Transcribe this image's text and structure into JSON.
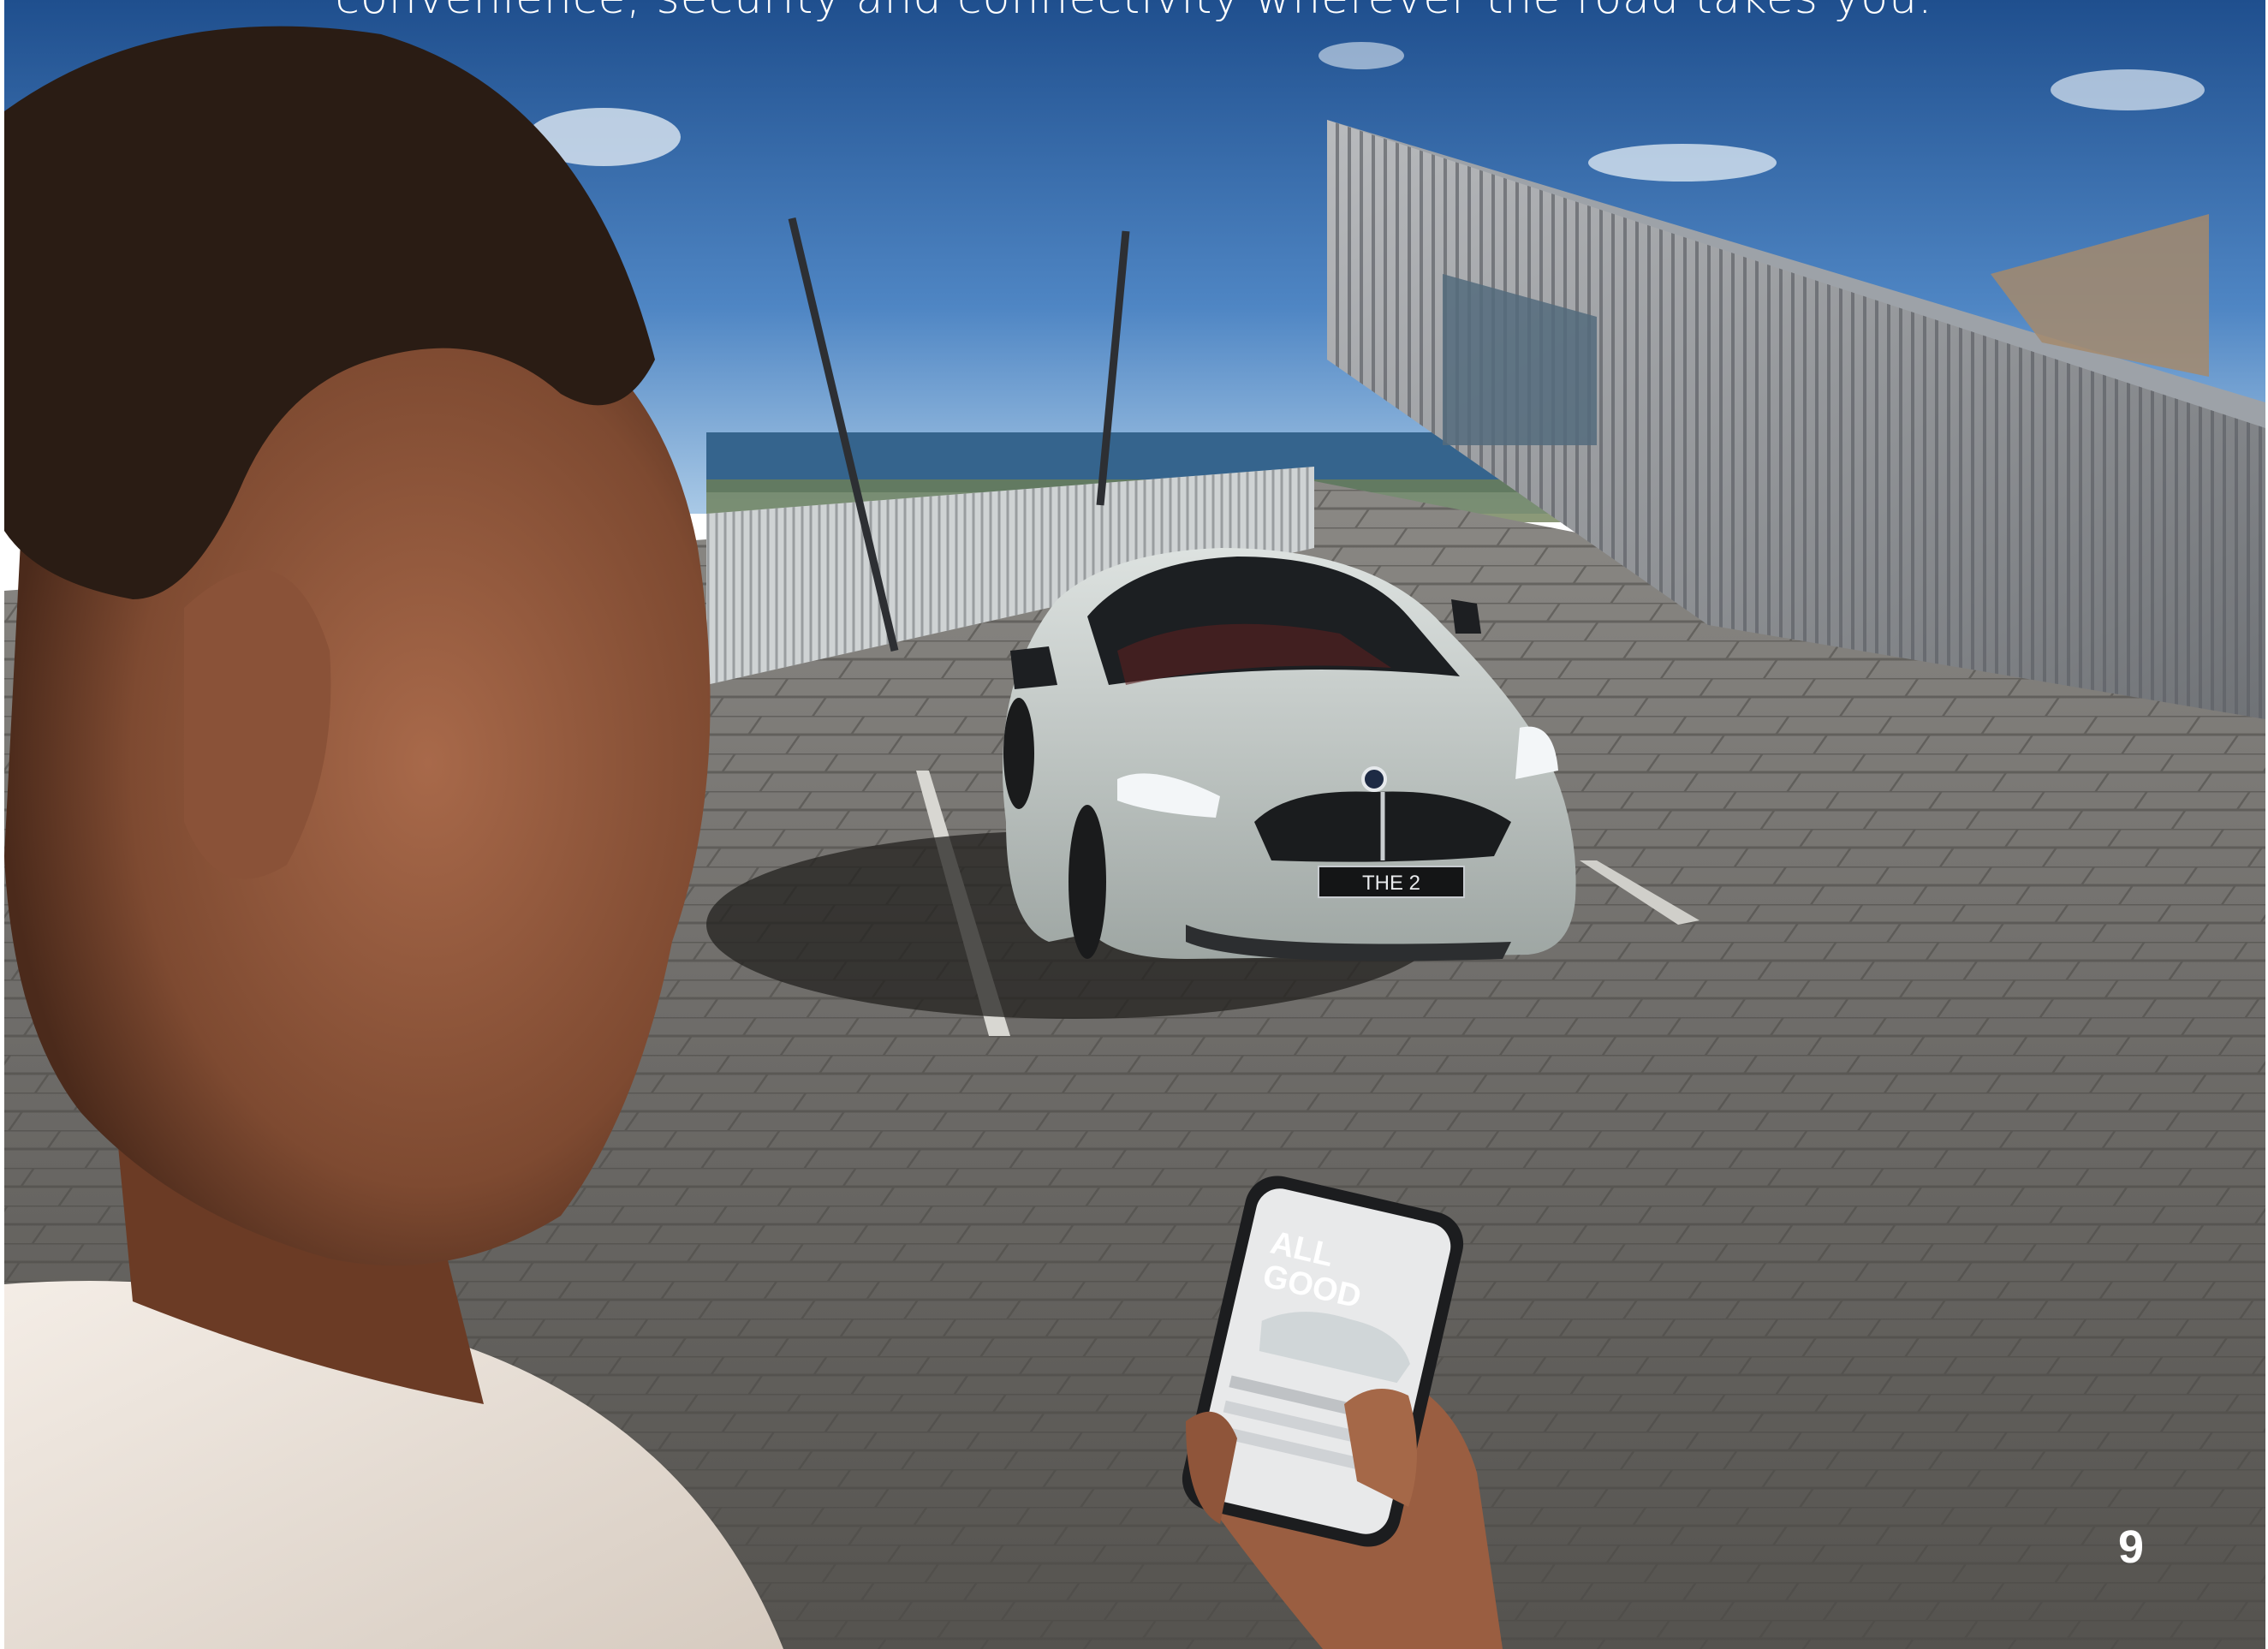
{
  "intro_text": "convenience, security and connectivity wherever the road takes you.",
  "page_number": "9",
  "car": {
    "plate_text": "THE 2"
  },
  "phone": {
    "screen_headline_line1": "ALL",
    "screen_headline_line2": "GOOD"
  },
  "colors": {
    "sky_top": "#2b5d9a",
    "sky_bottom": "#7fb0dc",
    "sea": "#2f5c83",
    "pavement": "#6e6c6a",
    "car_body": "#c5ccc9",
    "building_metal": "#8d9094",
    "skin": "#8a5438",
    "hair": "#2a1c14",
    "shirt": "#ece4dc"
  }
}
